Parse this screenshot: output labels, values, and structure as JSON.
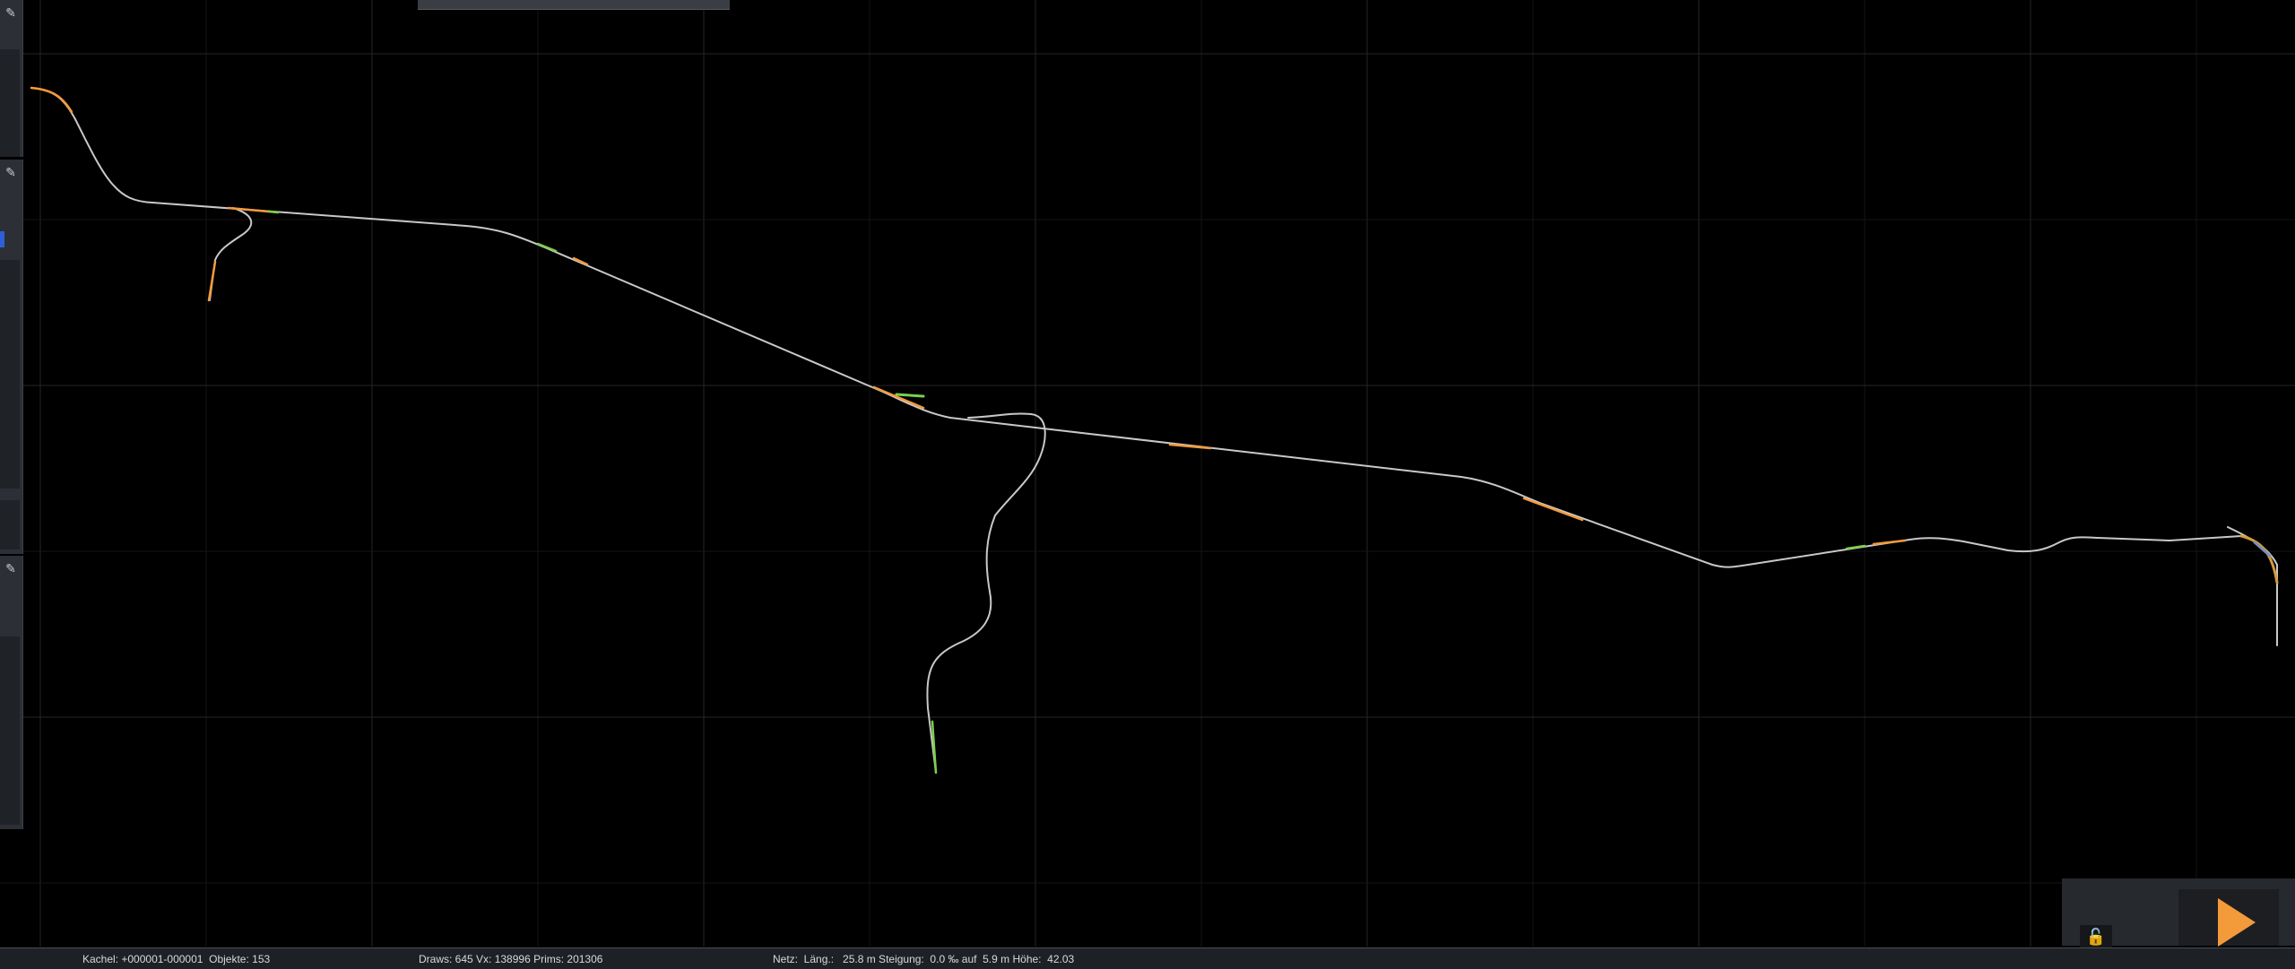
{
  "app": {
    "accent_color": "#f39a3a",
    "track_color": "#c8c8c8"
  },
  "panels": {
    "pin_icon_name": "pin-icon"
  },
  "controls": {
    "play_icon_name": "play-icon",
    "lock_icon_name": "unlock-icon",
    "lock_glyph": "🔓"
  },
  "status": {
    "tile": "Kachel: +000001-000001  Objekte: 153",
    "draws": "Draws: 645 Vx: 138996 Prims: 201306",
    "net": "Netz:  Läng.:   25.8 m Steigung:  0.0 ‰ auf  5.9 m Höhe:  42.03"
  }
}
